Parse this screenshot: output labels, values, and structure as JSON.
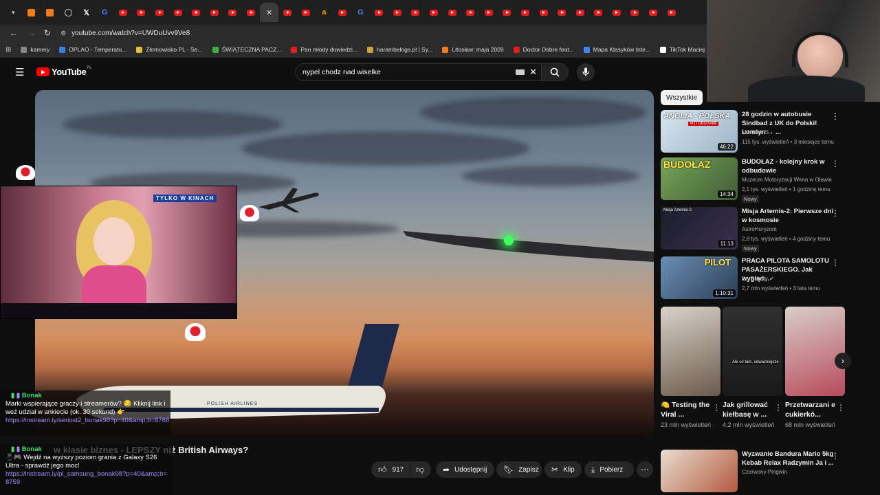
{
  "browser": {
    "url": "youtube.com/watch?v=UWDuUvv9Ve8",
    "bookmarks": [
      {
        "label": "kamery",
        "color": "#888888"
      },
      {
        "label": "OPLAO - Temperatu...",
        "color": "#3f7fe0"
      },
      {
        "label": "Złomowisko PL - Se...",
        "color": "#e0c040"
      },
      {
        "label": "ŚWIĄTECZNA PACZ...",
        "color": "#3cb043"
      },
      {
        "label": "Pan młody dowiedzi...",
        "color": "#e01e1e"
      },
      {
        "label": "harambelogs.pl | Sy...",
        "color": "#c9a43c"
      },
      {
        "label": "Litosław: maja 2009",
        "color": "#f07c1c"
      },
      {
        "label": "Doctor Dobre feat...",
        "color": "#e01e1e"
      },
      {
        "label": "Mapa Klasyków Inte...",
        "color": "#4285f4"
      },
      {
        "label": "TikTok Maciej (@ma...",
        "color": "#ffffff"
      }
    ]
  },
  "youtube": {
    "logo_text": "YouTube",
    "logo_region": "PL",
    "search_query": "nypel chodz nad wiselke",
    "video": {
      "title": "w klasie biznes - LEPSZY niż British Airways?",
      "likes": "917",
      "buttons": {
        "share": "Udostępnij",
        "save": "Zapisz",
        "clip": "Klip",
        "download": "Pobierz"
      },
      "plane_livery": "POLISH AIRLINES",
      "pip_banner": "TYLKO W KINACH"
    },
    "sidebar": {
      "chip": "Wszystkie",
      "items": [
        {
          "title": "28 godzin w autobusie Sindbad z UK do Polski! Londyn → ...",
          "channel": "MiNiMaLIS",
          "meta": "115 tys. wyświetleń • 3 miesiące temu",
          "duration": "46:22",
          "thumb_text": "ANGLIA - POLSKA",
          "thumb_sub": "AUTOBUSAMI"
        },
        {
          "title": "BUDOŁAZ - kolejny krok w odbudowie",
          "channel": "Muzeum Motoryzacji Wena w Oławie",
          "meta": "2,1 tys. wyświetleń • 1 godzinę temu",
          "duration": "14:34",
          "badge": "Nowy",
          "thumb_text": "BUDOŁAZ"
        },
        {
          "title": "Misja Artemis-2: Pierwsze dni w kosmosie",
          "channel": "AstroHoryzont",
          "meta": "2,8 tys. wyświetleń • 4 godziny temu",
          "duration": "11:13",
          "badge": "Nowy",
          "thumb_text": "Misja Artemis-2"
        },
        {
          "title": "PRACA PILOTA SAMOLOTU PASAŻERSKIEGO. Jak wygląd...",
          "channel": "Do Roboty",
          "meta": "2,7 mln wyświetleń • 3 lata temu",
          "duration": "1:10:31",
          "thumb_text": "PILOT"
        },
        {
          "title": "Wyzwanie Bandura Mario 5kg Kebab Relax Radzymin Ja i ...",
          "channel": "Czerwony Pingwin",
          "meta": ""
        }
      ],
      "shorts": [
        {
          "title": "🍋 Testing the Viral ...",
          "views": "23 mln wyświetleń"
        },
        {
          "title": "Jak grillować kiełbasę w ...",
          "views": "4,2 mln wyświetleń",
          "overlay": "Ale co tam, odważniejsze"
        },
        {
          "title": "Przetwarzani e cukierkó...",
          "views": "68 mln wyświetleń"
        }
      ]
    }
  },
  "chat": {
    "messages": [
      {
        "user": "Bonak",
        "text": "Marki wspierające graczy i streamerów? 😏 Kliknij link i weź udział w ankiecie (ok. 30 sekund) 👉",
        "link": "https://instream.ly/seriost2_bonak98?p=40&amp;b=8788"
      },
      {
        "user": "Bonak",
        "text": "📱🎮 Wejdź na wyższy poziom grania z Galaxy S26 Ultra - sprawdź jego moc!",
        "link": "https://instream.ly/pl_samsung_bonak98?p=40&amp;b=8759"
      }
    ]
  },
  "colors": {
    "yt_red": "#ff0000",
    "link_purple": "#a58bff",
    "user_green": "#45e06b"
  }
}
